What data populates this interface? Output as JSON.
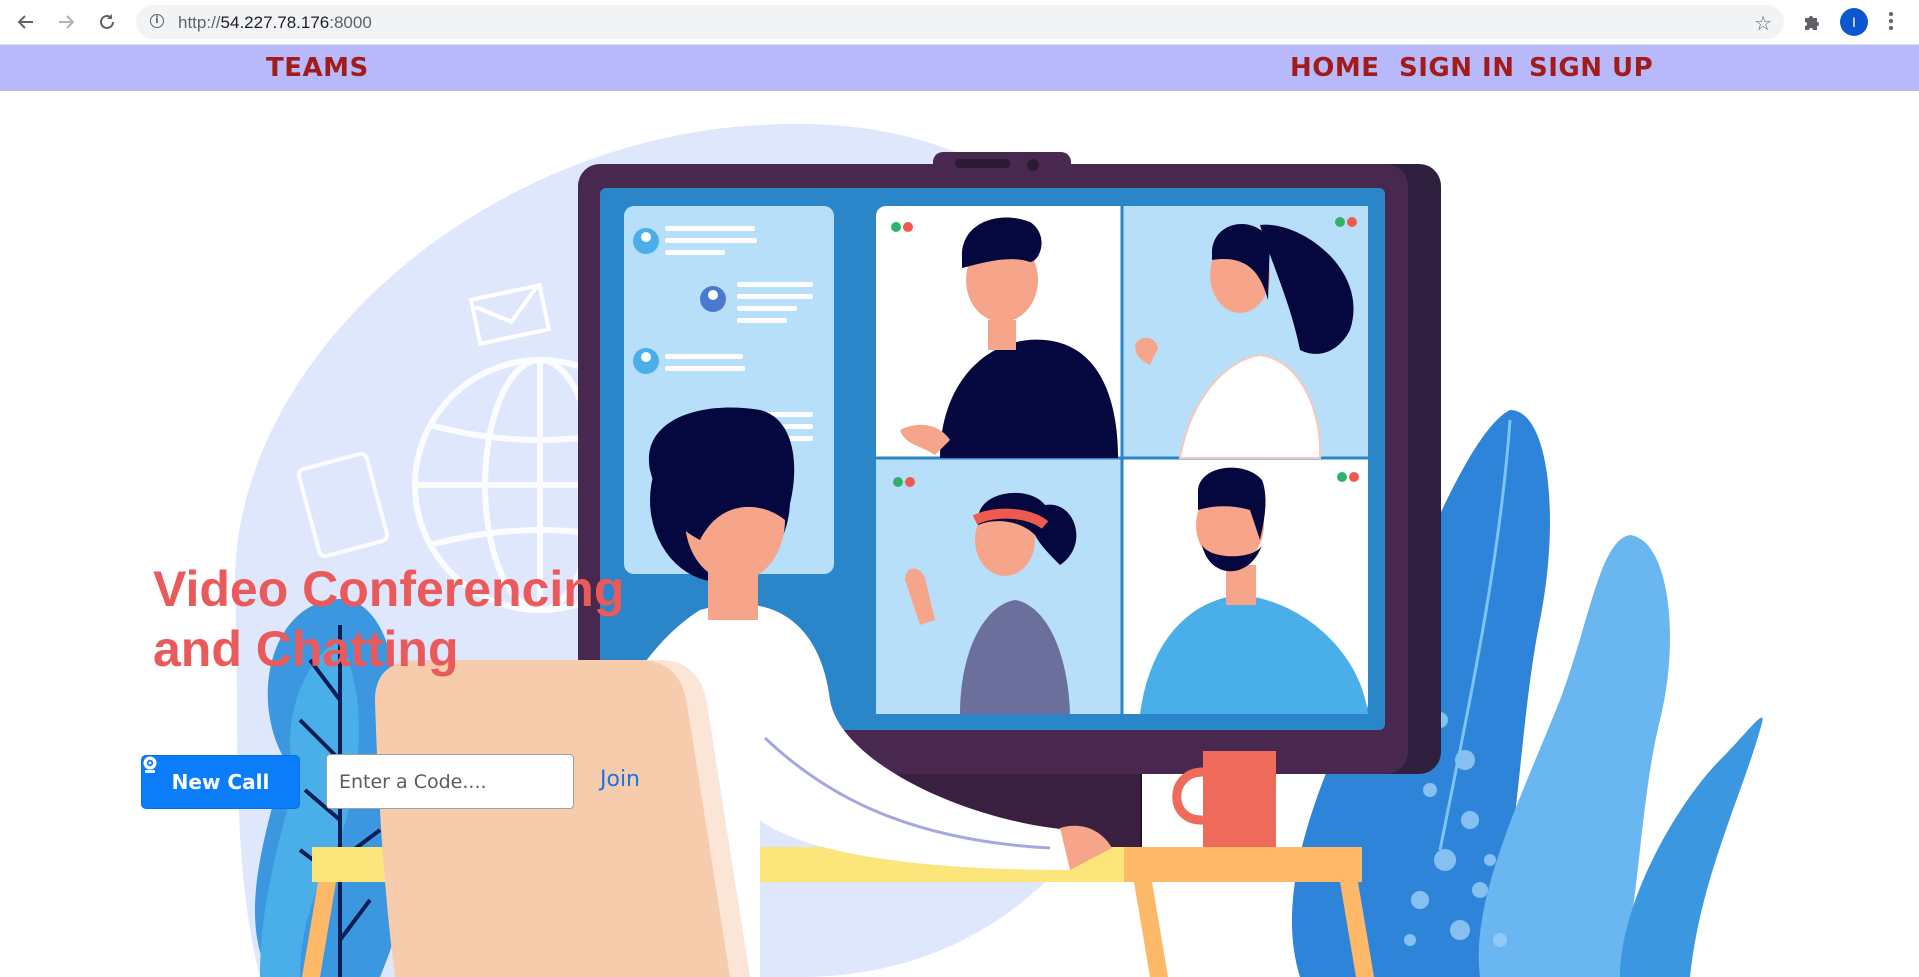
{
  "browser": {
    "back_icon": "arrow-left-icon",
    "forward_icon": "arrow-right-icon",
    "reload_icon": "reload-icon",
    "url_prefix": "http://",
    "url_host": "54.227.78.176",
    "url_port": ":8000",
    "avatar_letter": "I"
  },
  "nav": {
    "brand": "TEAMS",
    "links": [
      "HOME",
      "SIGN IN",
      "SIGN UP"
    ]
  },
  "hero": {
    "title_line1": "Video Conferencing",
    "title_line2": "and Chatting",
    "new_call_label": "New Call",
    "code_placeholder": "Enter a Code....",
    "join_label": "Join"
  },
  "colors": {
    "navbar_bg": "#b8b9fb",
    "nav_text": "#a11b1b",
    "title": "#eb5a5a",
    "primary_button": "#0b7dfa",
    "link": "#1a73e8"
  }
}
